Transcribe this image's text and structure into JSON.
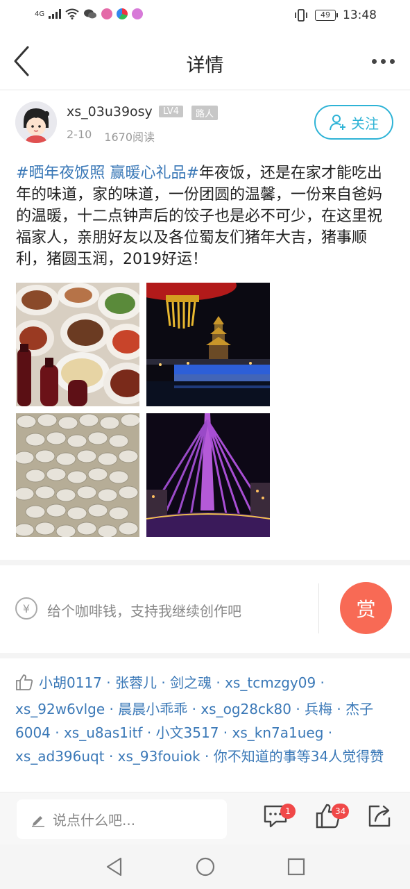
{
  "status_bar": {
    "network": "4G",
    "battery": "49",
    "time": "13:48"
  },
  "nav": {
    "title": "详情"
  },
  "author": {
    "username": "xs_03u39osy",
    "level_badge": "LV4",
    "role_badge": "路人",
    "date": "2-10",
    "reads": "1670阅读",
    "follow_label": "关注"
  },
  "post": {
    "tag1": "#晒年夜饭照",
    "tag2": "赢暖心礼品#",
    "body": "年夜饭，还是在家才能吃出年的味道，家的味道，一份团圆的温馨，一份来自爸妈的温暖，十二点钟声后的饺子也是必不可少，在这里祝福家人，亲朋好友以及各位蜀友们猪年大吉，猪事顺利，猪圆玉润，2019好运！"
  },
  "images": [
    {
      "name": "dinner-photo"
    },
    {
      "name": "pagoda-night-photo"
    },
    {
      "name": "dumplings-photo"
    },
    {
      "name": "bridge-night-photo"
    }
  ],
  "tip": {
    "yen_symbol": "¥",
    "text": "给个咖啡钱，支持我继续创作吧",
    "reward_label": "赏"
  },
  "likes": {
    "text": "小胡0117 · 张蓉儿 · 剑之魂 · xs_tcmzgy09 · xs_92w6vlge · 晨晨小乖乖 · xs_og28ck80 · 兵梅 · 杰子6004 · xs_u8as1itf · 小文3517 · xs_kn7a1ueg · xs_ad396uqt · xs_93fouiok · 你不知道的事等34人觉得赞"
  },
  "actions": {
    "comment_placeholder": "说点什么吧...",
    "comment_count": "1",
    "like_count": "34"
  },
  "colors": {
    "accent_blue": "#2eb3d6",
    "link_blue": "#3a78b7",
    "reward_orange": "#f86a55",
    "badge_red": "#f04848"
  }
}
